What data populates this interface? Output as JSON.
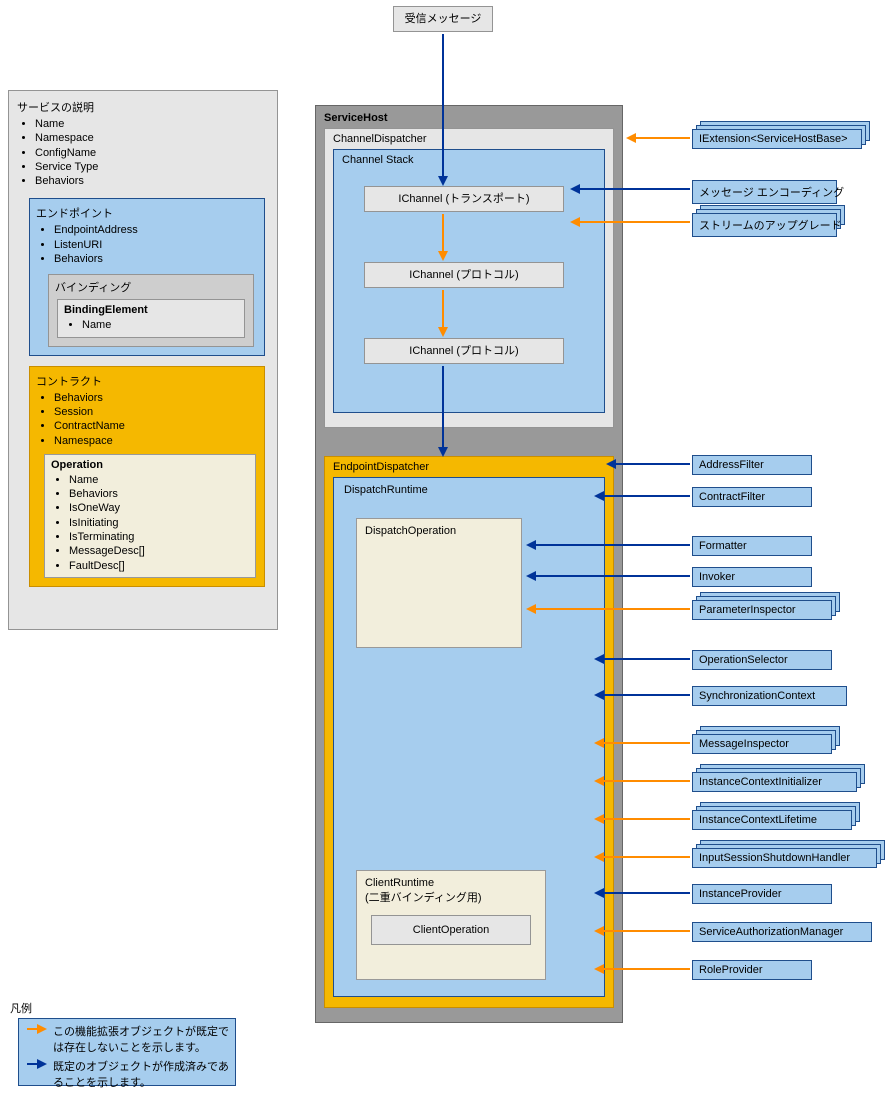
{
  "incoming_message": "受信メッセージ",
  "service_desc": {
    "title": "サービスの説明",
    "items": [
      "Name",
      "Namespace",
      "ConfigName",
      "Service Type",
      "Behaviors"
    ],
    "endpoint": {
      "title": "エンドポイント",
      "items": [
        "EndpointAddress",
        "ListenURI",
        "Behaviors"
      ],
      "binding": {
        "title": "バインディング",
        "element": "BindingElement",
        "items": [
          "Name"
        ]
      }
    },
    "contract": {
      "title": "コントラクト",
      "items": [
        "Behaviors",
        "Session",
        "ContractName",
        "Namespace"
      ],
      "operation": {
        "title": "Operation",
        "items": [
          "Name",
          "Behaviors",
          "IsOneWay",
          "IsInitiating",
          "IsTerminating",
          "MessageDesc[]",
          "FaultDesc[]"
        ]
      }
    }
  },
  "servicehost": {
    "title": "ServiceHost",
    "channel_dispatcher": {
      "title": "ChannelDispatcher",
      "channel_stack": {
        "title": "Channel Stack",
        "layers": [
          "IChannel (トランスポート)",
          "IChannel (プロトコル)",
          "IChannel (プロトコル)"
        ]
      }
    },
    "endpoint_dispatcher": {
      "title": "EndpointDispatcher",
      "dispatch_runtime": {
        "title": "DispatchRuntime",
        "dispatch_operation": "DispatchOperation",
        "client_runtime": {
          "title": "ClientRuntime",
          "subtitle": "(二重バインディング用)",
          "client_operation": "ClientOperation"
        }
      }
    }
  },
  "ext": {
    "iextension": "IExtension<ServiceHostBase>",
    "msg_encoding": "メッセージ エンコーディング",
    "stream_upgrade": "ストリームのアップグレード",
    "address_filter": "AddressFilter",
    "contract_filter": "ContractFilter",
    "formatter": "Formatter",
    "invoker": "Invoker",
    "param_inspector": "ParameterInspector",
    "operation_selector": "OperationSelector",
    "sync_context": "SynchronizationContext",
    "message_inspector": "MessageInspector",
    "ictx_initializer": "InstanceContextInitializer",
    "ictx_lifetime": "InstanceContextLifetime",
    "input_session_shutdown": "InputSessionShutdownHandler",
    "instance_provider": "InstanceProvider",
    "svc_auth_mgr": "ServiceAuthorizationManager",
    "role_provider": "RoleProvider"
  },
  "legend": {
    "title": "凡例",
    "orange": "この機能拡張オブジェクトが既定では存在しないことを示します。",
    "blue": "既定のオブジェクトが作成済みであることを示します。"
  }
}
